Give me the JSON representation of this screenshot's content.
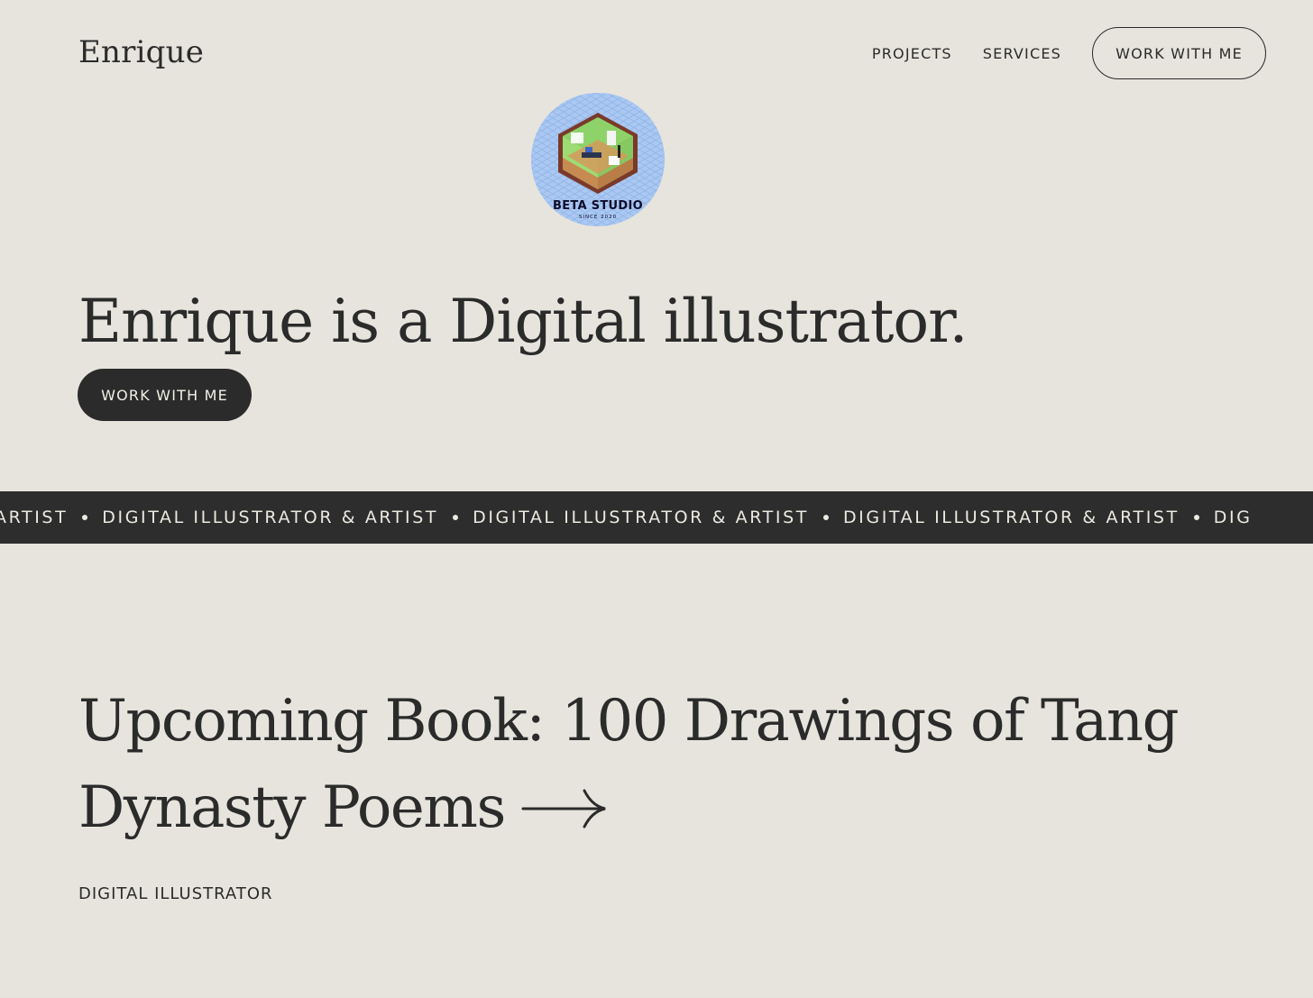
{
  "header": {
    "brand": "Enrique",
    "nav": [
      {
        "label": "PROJECTS"
      },
      {
        "label": "SERVICES"
      }
    ],
    "cta_label": "WORK WITH ME"
  },
  "logo": {
    "title": "BETA STUDIO",
    "subtitle": "SINCE 2020"
  },
  "hero": {
    "title": "Enrique is a Digital illustrator.",
    "cta_label": "WORK WITH ME"
  },
  "marquee": {
    "items": [
      "ARTIST",
      "DIGITAL ILLUSTRATOR & ARTIST",
      "DIGITAL ILLUSTRATOR & ARTIST",
      "DIGITAL ILLUSTRATOR & ARTIST",
      "DIG"
    ]
  },
  "book": {
    "title": "Upcoming Book: 100 Drawings of Tang Dynasty Poems"
  },
  "tagline": "DIGITAL ILLUSTRATOR",
  "colors": {
    "background": "#e6e4dd",
    "ink": "#2b2b2b",
    "marquee_bg": "#2d2d2d",
    "logo_bg": "#a9c8f3"
  }
}
